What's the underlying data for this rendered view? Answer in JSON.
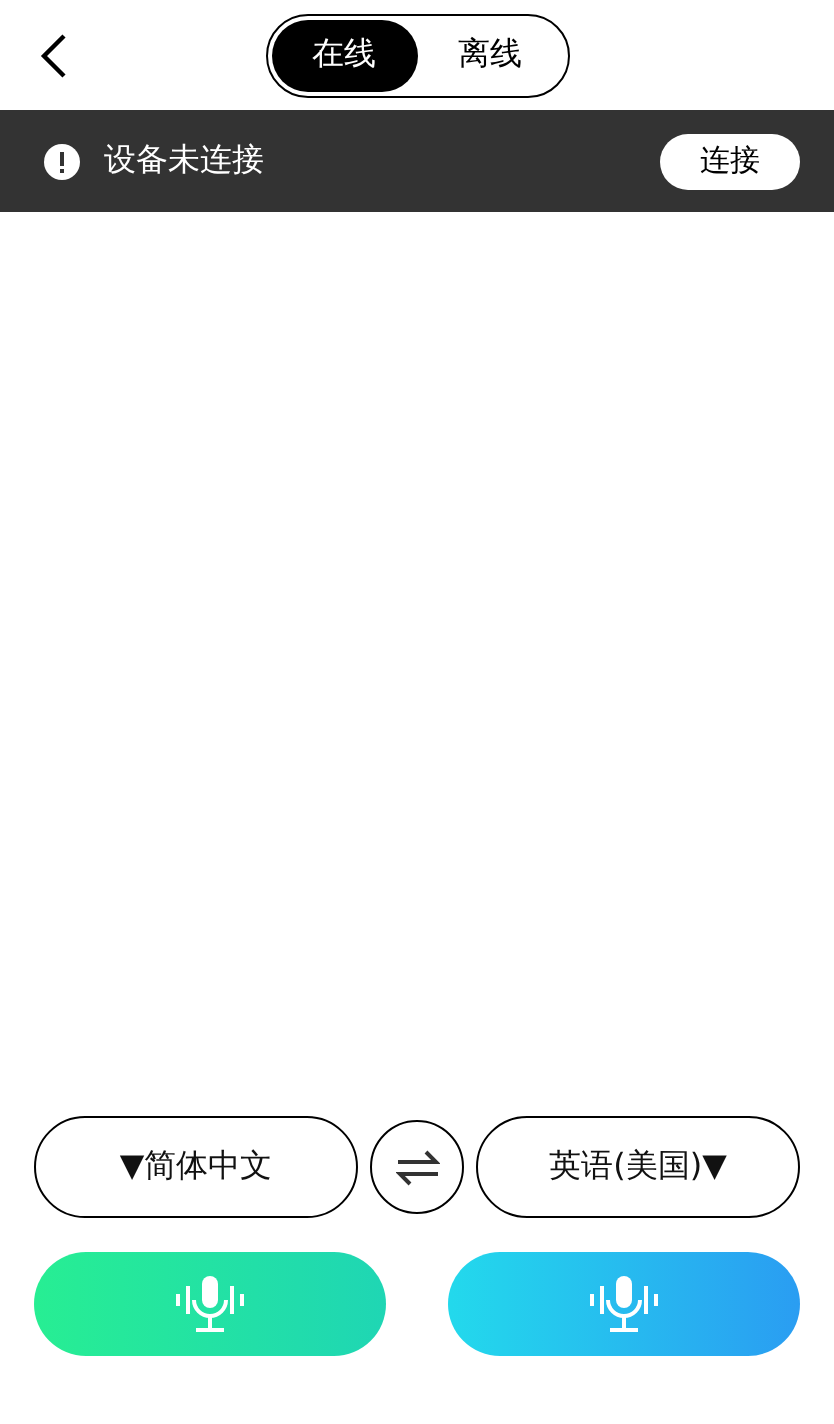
{
  "segments": [
    {
      "label": "在线",
      "selected": true
    },
    {
      "label": "离线",
      "selected": false
    }
  ],
  "banner": {
    "message": "设备未连接",
    "button": "连接"
  },
  "languages": {
    "source": "▼简体中文",
    "target": "英语(美国)▼"
  }
}
